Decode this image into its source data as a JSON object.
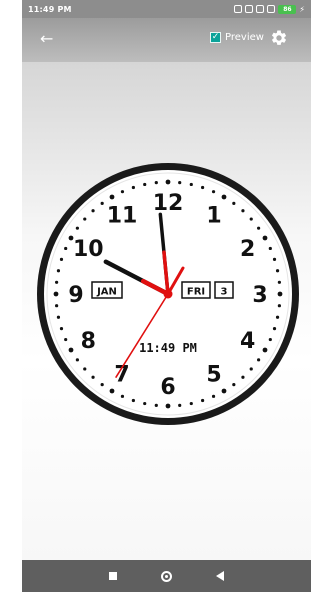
{
  "status_bar": {
    "time": "11:49 PM",
    "battery": "86",
    "icons": [
      "alarm-icon",
      "notification-icon",
      "signal-icon",
      "signal-icon",
      "wifi-icon",
      "battery-icon",
      "charging-icon"
    ]
  },
  "app_bar": {
    "back_icon": "arrow-left-icon",
    "preview_label": "Preview",
    "preview_checked": true,
    "settings_icon": "gear-icon"
  },
  "clock": {
    "numbers": [
      "12",
      "1",
      "2",
      "3",
      "4",
      "5",
      "6",
      "7",
      "8",
      "9",
      "10",
      "11"
    ],
    "month": "JAN",
    "weekday": "FRI",
    "day": "3",
    "digital_time": "11:49 PM",
    "time_shown": {
      "hour": 11,
      "minute": 49,
      "second": 34
    },
    "colors": {
      "ring": "#1a1a1a",
      "hand": "#111111",
      "accent": "#e01010",
      "second_hand": "#e01010"
    }
  },
  "nav_bar": {
    "icons": [
      "recent-apps-icon",
      "home-icon",
      "back-icon"
    ]
  }
}
